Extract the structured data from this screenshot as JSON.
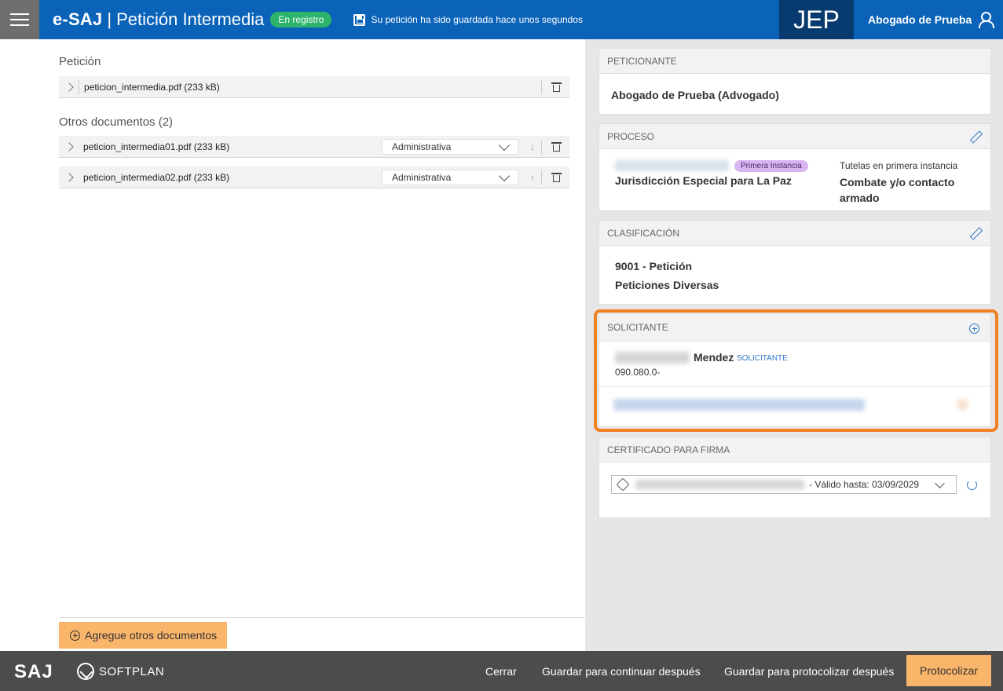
{
  "header": {
    "brand": "e-SAJ",
    "separator": "|",
    "page_title": "Petición Intermedia",
    "status_badge": "En registro",
    "save_status": "Su petición ha sido guardada hace unos segundos",
    "org_logo": "JEP",
    "user_name": "Abogado de Prueba",
    "icons": [
      "hamburger-menu-icon",
      "floppy-disk-icon",
      "user-icon"
    ],
    "colors": {
      "header_bg": "#0a63b8",
      "badge_green": "#2db36c",
      "jep_bg": "#073a6e"
    }
  },
  "left": {
    "peticion_title": "Petición",
    "peticion_doc": "peticion_intermedia.pdf (233 kB)",
    "otros_title": "Otros documentos (2)",
    "otros_docs": [
      {
        "name": "peticion_intermedia01.pdf (233 kB)",
        "type": "Administrativa",
        "move": "↓"
      },
      {
        "name": "peticion_intermedia02.pdf (233 kB)",
        "type": "Administrativa",
        "move": "↑"
      }
    ],
    "add_button": "Agregue otros documentos"
  },
  "right": {
    "peticionante": {
      "title": "PETICIONANTE",
      "value": "Abogado de Prueba (Advogado)"
    },
    "proceso": {
      "title": "PROCESO",
      "instance_badge": "Primera Instancia",
      "jurisdiction": "Jurisdicción Especial para La Paz",
      "subject_label": "Tutelas en primera instancia",
      "subject_value": "Combate y/o contacto armado"
    },
    "clasificacion": {
      "title": "CLASIFICACIÓN",
      "line1": "9001 - Petición",
      "line2": "Peticiones Diversas"
    },
    "solicitante": {
      "title": "SOLICITANTE",
      "surname": "Mendez",
      "role": "SOLICITANTE",
      "id_number": "090.080.0-"
    },
    "certificado": {
      "title": "CERTIFICADO PARA FIRMA",
      "validity": "- Válido hasta: 03/09/2029"
    },
    "colors": {
      "accent_blue": "#2f78c5",
      "highlight_orange": "#f08222",
      "badge_purple": "#d8b4f0"
    }
  },
  "footer": {
    "logo_saj": "SAJ",
    "logo_softplan": "SOFTPLAN",
    "cerrar": "Cerrar",
    "guardar_continuar": "Guardar para continuar después",
    "guardar_protocolizar": "Guardar para protocolizar después",
    "protocolizar": "Protocolizar",
    "colors": {
      "footer_bg": "#4c4c4c",
      "primary_button": "#f9b56a"
    }
  }
}
